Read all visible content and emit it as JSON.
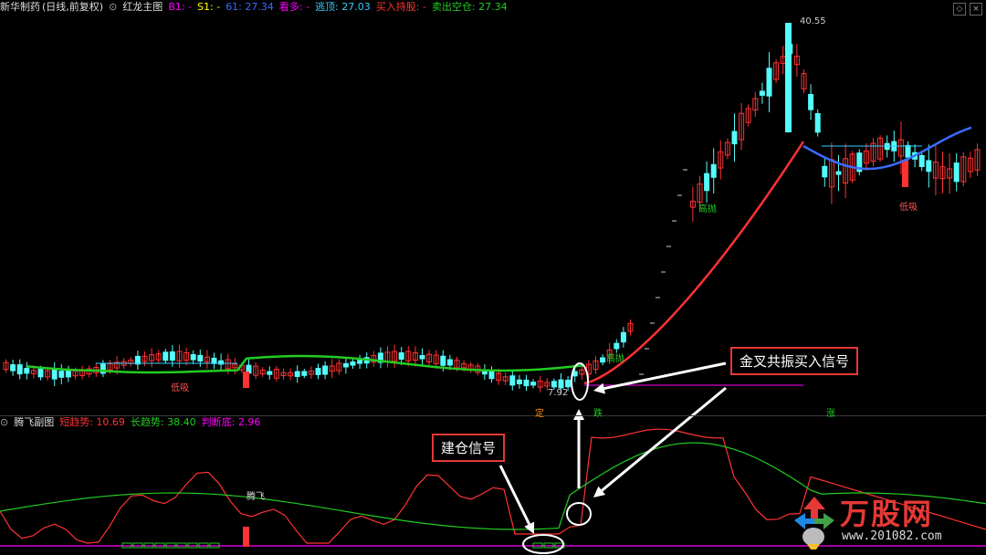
{
  "main_header": {
    "stock": "新华制药",
    "period": "(日线,前复权)",
    "indicator": "红龙主图",
    "fields": [
      {
        "label": "B1:",
        "value": "-",
        "color": "#ff00ff"
      },
      {
        "label": "S1:",
        "value": "-",
        "color": "#ffff00"
      },
      {
        "label": "61:",
        "value": "27.34",
        "color": "#3b6bff"
      },
      {
        "label": "看多:",
        "value": "-",
        "color": "#ff00ff"
      },
      {
        "label": "逃顶:",
        "value": "27.03",
        "color": "#33ccff"
      },
      {
        "label": "买入持股:",
        "value": "-",
        "color": "#ff3333"
      },
      {
        "label": "卖出空仓:",
        "value": "27.34",
        "color": "#22cc22"
      }
    ]
  },
  "sub_header": {
    "indicator": "腾飞副图",
    "fields": [
      {
        "label": "短趋势:",
        "value": "10.69",
        "color": "#ff3333"
      },
      {
        "label": "长趋势:",
        "value": "38.40",
        "color": "#22cc22"
      },
      {
        "label": "判断底:",
        "value": "2.96",
        "color": "#ff00ff"
      }
    ]
  },
  "price_labels": {
    "high": "40.55",
    "low": "7.92"
  },
  "signals": {
    "gaoxian_1": "高抛",
    "gaoxian_2": "高抛",
    "dixi_1": "低吸",
    "dixi_2": "低吸",
    "tengfei": "腾飞",
    "box_1": "定",
    "box_2": "跌",
    "box_3": "涨"
  },
  "callouts": {
    "golden_cross": "金叉共振买入信号",
    "build_position": "建仓信号"
  },
  "watermark": {
    "brand": "万股网",
    "url": "www.201082.com"
  },
  "colors": {
    "up": "#ff3232",
    "down": "#54fcfc",
    "short_trend": "#ff3333",
    "long_trend": "#22cc22",
    "bottom": "#ff00ff"
  }
}
